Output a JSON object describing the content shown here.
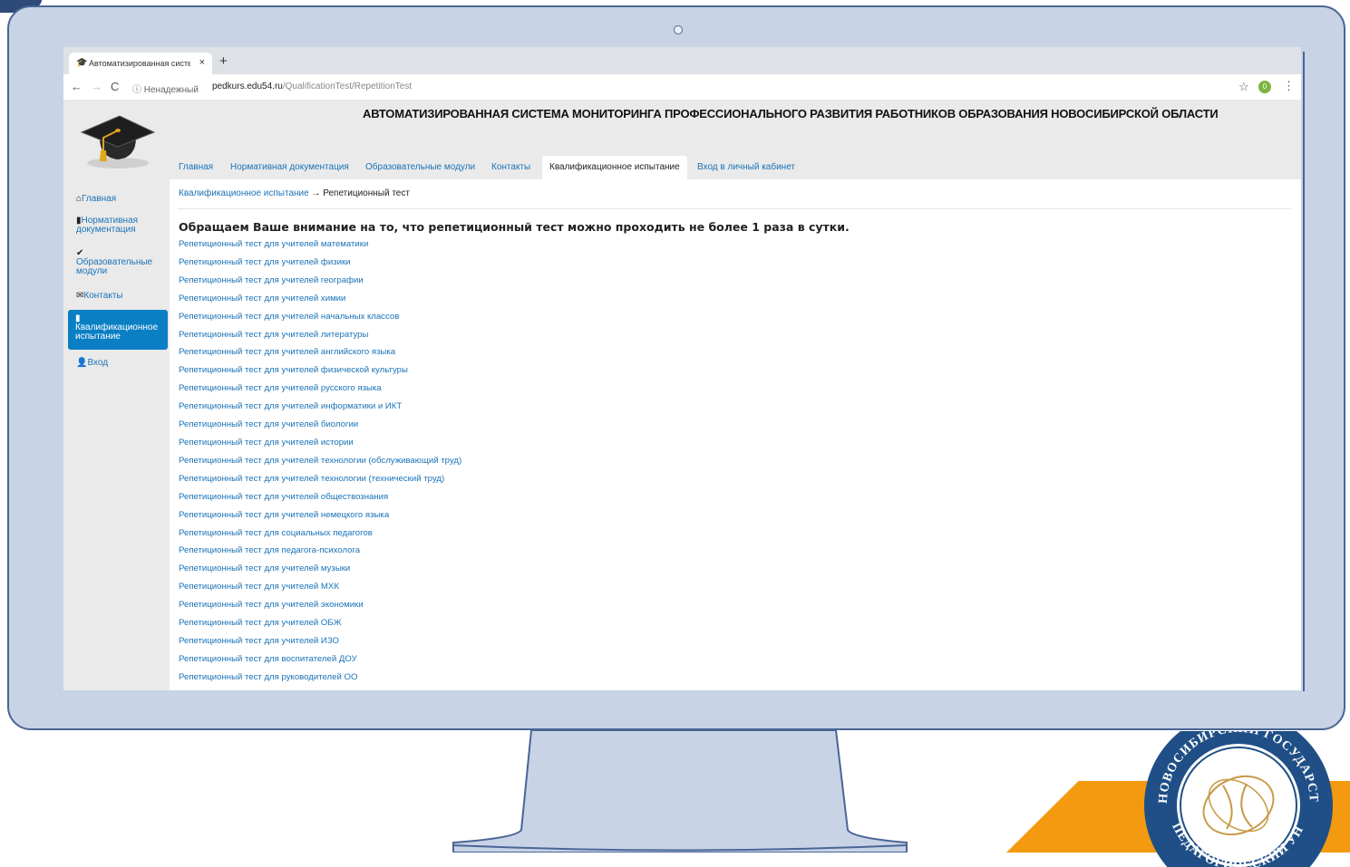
{
  "browser": {
    "tab_title": "Автоматизированная систем",
    "tab_close": "×",
    "new_tab": "+",
    "back": "←",
    "forward": "→",
    "reload": "C",
    "security_label": "ⓘ Ненадежный",
    "url_host": "pedkurs.edu54.ru",
    "url_path": "/QualificationTest/RepetitionTest",
    "star": "☆",
    "extension_badge": "0",
    "menu": "⋮"
  },
  "site": {
    "title": "АВТОМАТИЗИРОВАННАЯ СИСТЕМА МОНИТОРИНГА ПРОФЕССИОНАЛЬНОГО РАЗВИТИЯ РАБОТНИКОВ ОБРАЗОВАНИЯ НОВОСИБИРСКОЙ ОБЛАСТИ",
    "topnav": [
      {
        "label": "Главная"
      },
      {
        "label": "Нормативная документация"
      },
      {
        "label": "Образовательные модули"
      },
      {
        "label": "Контакты"
      },
      {
        "label": "Квалификационное испытание"
      },
      {
        "label": "Вход в личный кабинет"
      }
    ],
    "sidebar": [
      {
        "icon": "home-icon",
        "label": "Главная"
      },
      {
        "icon": "book-icon",
        "label1": "Нормативная",
        "label2": "документация"
      },
      {
        "icon": "check-icon",
        "label1": "Образовательные",
        "label2": "модули"
      },
      {
        "icon": "envelope-icon",
        "label": "Контакты"
      },
      {
        "icon": "book-icon",
        "label1": "Квалификационное",
        "label2": "испытание"
      },
      {
        "icon": "user-icon",
        "label": "Вход"
      }
    ]
  },
  "content": {
    "breadcrumb_link": "Квалификационное испытание",
    "breadcrumb_sep": "→",
    "breadcrumb_current": "Репетиционный тест",
    "notice": "Обращаем Ваше внимание на то, что репетиционный тест можно проходить не более 1 раза в сутки.",
    "tests": [
      "Репетиционный тест для учителей математики",
      "Репетиционный тест для учителей физики",
      "Репетиционный тест для учителей географии",
      "Репетиционный тест для учителей химии",
      "Репетиционный тест для учителей начальных классов",
      "Репетиционный тест для учителей литературы",
      "Репетиционный тест для учителей английского языка",
      "Репетиционный тест для учителей физической культуры",
      "Репетиционный тест для учителей русского языка",
      "Репетиционный тест для учителей информатики и ИКТ",
      "Репетиционный тест для учителей биологии",
      "Репетиционный тест для учителей истории",
      "Репетиционный тест для учителей технологии (обслуживающий труд)",
      "Репетиционный тест для учителей технологии (технический труд)",
      "Репетиционный тест для учителей обществознания",
      "Репетиционный тест для учителей немецкого языка",
      "Репетиционный тест для социальных педагогов",
      "Репетиционный тест для педагога-психолога",
      "Репетиционный тест для учителей музыки",
      "Репетиционный тест для учителей МХК",
      "Репетиционный тест для учителей экономики",
      "Репетиционный тест для учителей ОБЖ",
      "Репетиционный тест для учителей ИЗО",
      "Репетиционный тест для воспитателей ДОУ",
      "Репетиционный тест для руководителей ОО"
    ]
  },
  "seal": {
    "top_text": "НОВОСИБИРСКИЙ ГОСУДАРСТВЕННЫЙ",
    "bottom_text": "ПЕДАГОГИЧЕСКИЙ УНИВЕРСИТЕТ"
  },
  "colors": {
    "monitor_frame": "#c8d3e6",
    "link": "#1a73b8",
    "active_nav": "#0a7fc4",
    "accent_orange": "#f39a10"
  }
}
